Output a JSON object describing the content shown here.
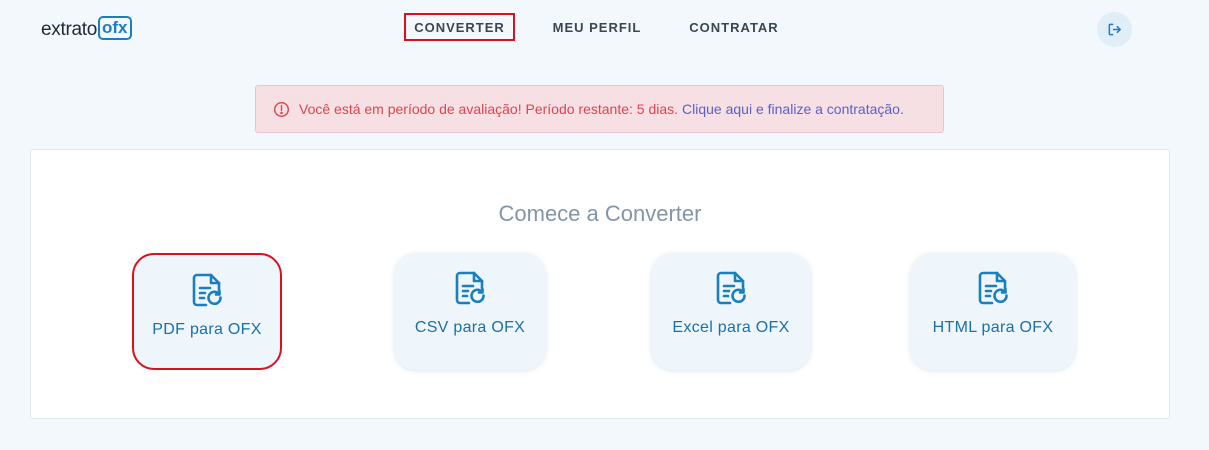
{
  "logo": {
    "text": "extrato",
    "box_text": "ofx"
  },
  "nav": [
    {
      "label": "CONVERTER",
      "active": true
    },
    {
      "label": "MEU PERFIL",
      "active": false
    },
    {
      "label": "CONTRATAR",
      "active": false
    }
  ],
  "logout": {
    "icon": "logout-icon"
  },
  "alert": {
    "icon": "info-circle-icon",
    "message": "Você está em período de avaliação! Período restante: 5 dias.",
    "link": "Clique aqui e finalize a contratação."
  },
  "main": {
    "title": "Comece a Converter",
    "options": [
      {
        "label": "PDF para OFX",
        "icon": "file-convert-icon",
        "selected": true
      },
      {
        "label": "CSV para OFX",
        "icon": "file-convert-icon",
        "selected": false
      },
      {
        "label": "Excel para OFX",
        "icon": "file-convert-icon",
        "selected": false
      },
      {
        "label": "HTML para OFX",
        "icon": "file-convert-icon",
        "selected": false
      }
    ]
  },
  "colors": {
    "background": "#f3f8fc",
    "accent": "#1a7fbf",
    "highlight_border": "#d7121e",
    "alert_text": "#e0434f",
    "alert_link": "#5b5fc7"
  }
}
